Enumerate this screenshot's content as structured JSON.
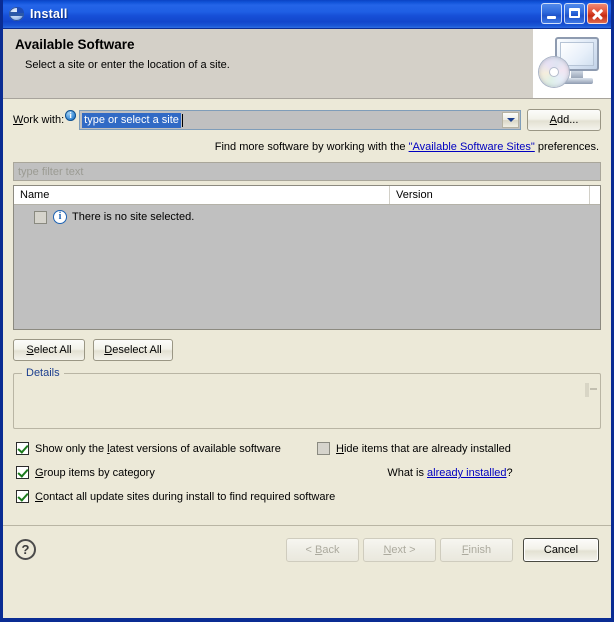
{
  "window": {
    "title": "Install",
    "icon": "eclipse-install-icon",
    "controls": {
      "minimize": "minimize-button",
      "maximize": "maximize-button",
      "close": "close-button"
    }
  },
  "header": {
    "title": "Available Software",
    "subtitle": "Select a site or enter the location of a site.",
    "image": "monitor-cd-icon"
  },
  "work_with": {
    "label_prefix": "W",
    "label_mnemonic": "W",
    "label": "Work with:",
    "info_icon": "info-icon",
    "value": "type or select a site",
    "add_button": "Add...",
    "add_button_mnemonic": "A"
  },
  "hint": {
    "prefix": "Find more software by working with the ",
    "link": "\"Available Software Sites\"",
    "suffix": " preferences."
  },
  "filter": {
    "placeholder": "type filter text",
    "value": ""
  },
  "table": {
    "columns": [
      "Name",
      "Version",
      ""
    ],
    "rows": [
      {
        "checked": false,
        "icon": "info-icon",
        "name": "There is no site selected.",
        "version": ""
      }
    ]
  },
  "selection_buttons": {
    "select_all": "Select All",
    "deselect_all": "Deselect All"
  },
  "details": {
    "label": "Details",
    "content": ""
  },
  "options": [
    {
      "label": "Show only the latest versions of available software",
      "checked": true
    },
    {
      "label": "Group items by category",
      "checked": true
    },
    {
      "label": "Contact all update sites during install to find required software",
      "checked": true
    },
    {
      "label": "Hide items that are already installed",
      "checked": false
    }
  ],
  "what_is": {
    "prefix": "What is ",
    "link": "already installed",
    "suffix": "?"
  },
  "footer": {
    "help": "?",
    "back": "< Back",
    "next": "Next >",
    "finish": "Finish",
    "cancel": "Cancel"
  },
  "colors": {
    "title_bar": "#1750d8",
    "dialog_background": "#ece9d8",
    "header_background": "#d4d0c8",
    "list_background": "#c0c0c0",
    "selection": "#316ac5",
    "link": "#0000c0",
    "group_label": "#1c3f8f",
    "check_mark": "#1c7a1c"
  }
}
